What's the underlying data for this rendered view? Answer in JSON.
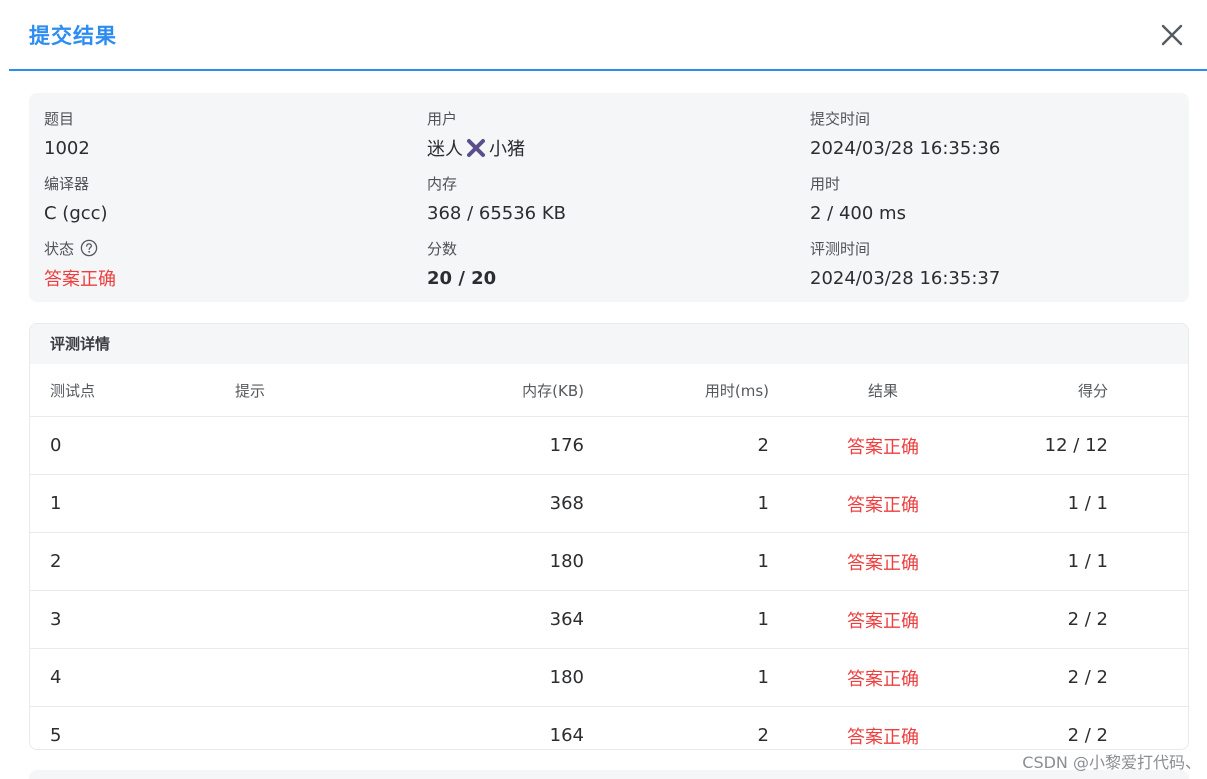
{
  "dialog": {
    "title": "提交结果"
  },
  "info": {
    "problem": {
      "label": "题目",
      "value": "1002"
    },
    "user": {
      "label": "用户",
      "name_part1": "迷人",
      "name_part2": "小猪"
    },
    "submit_time": {
      "label": "提交时间",
      "value": "2024/03/28 16:35:36"
    },
    "compiler": {
      "label": "编译器",
      "value": "C (gcc)"
    },
    "memory": {
      "label": "内存",
      "value": "368 / 65536 KB"
    },
    "time_used": {
      "label": "用时",
      "value": "2 / 400 ms"
    },
    "status": {
      "label": "状态",
      "value": "答案正确"
    },
    "score": {
      "label": "分数",
      "value": "20 / 20"
    },
    "judge_time": {
      "label": "评测时间",
      "value": "2024/03/28 16:35:37"
    }
  },
  "detail": {
    "title": "评测详情",
    "columns": [
      "测试点",
      "提示",
      "内存(KB)",
      "用时(ms)",
      "结果",
      "得分"
    ],
    "rows": [
      [
        "0",
        "",
        "176",
        "2",
        "答案正确",
        "12 / 12"
      ],
      [
        "1",
        "",
        "368",
        "1",
        "答案正确",
        "1 / 1"
      ],
      [
        "2",
        "",
        "180",
        "1",
        "答案正确",
        "1 / 1"
      ],
      [
        "3",
        "",
        "364",
        "1",
        "答案正确",
        "2 / 2"
      ],
      [
        "4",
        "",
        "180",
        "1",
        "答案正确",
        "2 / 2"
      ],
      [
        "5",
        "",
        "164",
        "2",
        "答案正确",
        "2 / 2"
      ]
    ]
  },
  "watermark": "CSDN @小黎爱打代码、",
  "colors": {
    "accent": "#2d8cf0",
    "success_text": "#ed3f3f",
    "card_bg": "#f5f6f8"
  },
  "icons": {
    "close": "close-icon",
    "status_help": "question-circle-icon",
    "user_name_symbol": "cross-mark-icon"
  }
}
